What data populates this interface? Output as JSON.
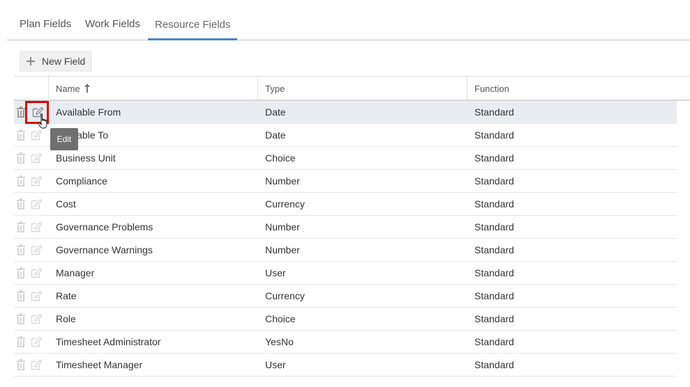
{
  "tabs": [
    {
      "label": "Plan Fields",
      "active": false
    },
    {
      "label": "Work Fields",
      "active": false
    },
    {
      "label": "Resource Fields",
      "active": true
    }
  ],
  "toolbar": {
    "new_field_label": "New Field",
    "new_field_icon": "plus-icon"
  },
  "table": {
    "columns": {
      "name": "Name",
      "type": "Type",
      "function": "Function"
    },
    "sort": {
      "column": "Name",
      "direction": "ascending"
    },
    "rows": [
      {
        "name": "Available From",
        "type": "Date",
        "function": "Standard"
      },
      {
        "name": "Available To",
        "type": "Date",
        "function": "Standard"
      },
      {
        "name": "Business Unit",
        "type": "Choice",
        "function": "Standard"
      },
      {
        "name": "Compliance",
        "type": "Number",
        "function": "Standard"
      },
      {
        "name": "Cost",
        "type": "Currency",
        "function": "Standard"
      },
      {
        "name": "Governance Problems",
        "type": "Number",
        "function": "Standard"
      },
      {
        "name": "Governance Warnings",
        "type": "Number",
        "function": "Standard"
      },
      {
        "name": "Manager",
        "type": "User",
        "function": "Standard"
      },
      {
        "name": "Rate",
        "type": "Currency",
        "function": "Standard"
      },
      {
        "name": "Role",
        "type": "Choice",
        "function": "Standard"
      },
      {
        "name": "Timesheet Administrator",
        "type": "YesNo",
        "function": "Standard"
      },
      {
        "name": "Timesheet Manager",
        "type": "User",
        "function": "Standard"
      }
    ]
  },
  "tooltip": {
    "text": "Edit"
  },
  "colors": {
    "active_tab_underline": "#4a86c5",
    "highlight_box": "#e00000",
    "hover_row": "#e9edf1"
  }
}
